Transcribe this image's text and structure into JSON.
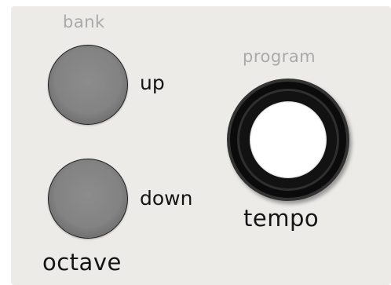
{
  "bank": {
    "section_label": "bank",
    "up_label": "up",
    "down_label": "down",
    "octave_label": "octave"
  },
  "program": {
    "section_label": "program",
    "tempo_label": "tempo"
  },
  "colors": {
    "panel_background": "#ecebe8",
    "section_label": "#a9a9a9",
    "button_label": "#141414",
    "bank_button_fill": "#838383",
    "program_ring": "#0b0b0b",
    "program_center": "#ffffff"
  }
}
